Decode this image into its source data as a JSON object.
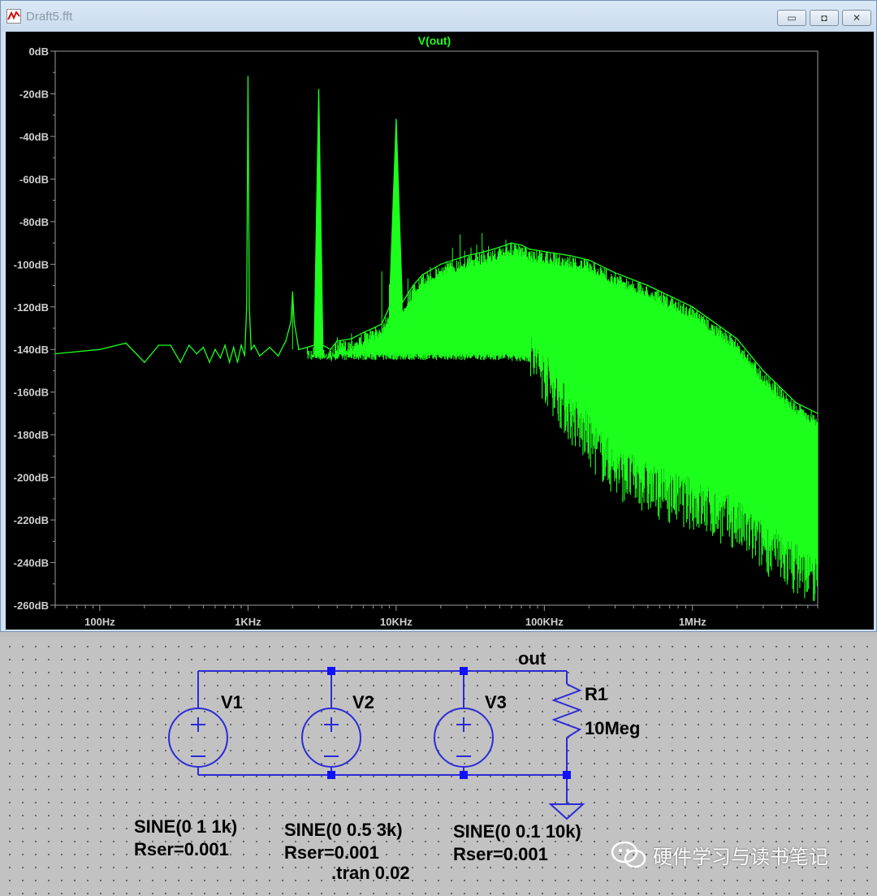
{
  "window": {
    "title": "Draft5.fft",
    "buttons": {
      "minimize": "minimize",
      "maximize": "maximize",
      "close": "close"
    }
  },
  "plot": {
    "trace_name": "V(out)",
    "trace_color": "#1cff1c",
    "background": "#000000"
  },
  "chart_data": {
    "type": "line",
    "title": "V(out)",
    "xscale": "log",
    "xlim": [
      50,
      7000000
    ],
    "ylim": [
      -260,
      0
    ],
    "yticks": [
      "0dB",
      "-20dB",
      "-40dB",
      "-60dB",
      "-80dB",
      "-100dB",
      "-120dB",
      "-140dB",
      "-160dB",
      "-180dB",
      "-200dB",
      "-220dB",
      "-240dB",
      "-260dB"
    ],
    "xticks": [
      "100Hz",
      "1KHz",
      "10KHz",
      "100KHz",
      "1MHz"
    ],
    "grid": false,
    "series": [
      {
        "name": "V(out)",
        "x": [
          50,
          100,
          150,
          200,
          250,
          300,
          350,
          400,
          450,
          500,
          550,
          600,
          650,
          700,
          750,
          800,
          850,
          900,
          950,
          980,
          1000,
          1020,
          1050,
          1100,
          1200,
          1400,
          1600,
          1800,
          1950,
          2000,
          2050,
          2200,
          2500,
          2800,
          3000,
          3200,
          3600,
          4000,
          5000,
          6000,
          7000,
          8000,
          9000,
          10000,
          11000,
          13000,
          15000,
          20000,
          30000,
          40000,
          50000,
          60000,
          70000,
          80000,
          100000,
          150000,
          200000,
          300000,
          500000,
          1000000,
          2000000,
          3000000,
          5000000,
          7000000
        ],
        "values": [
          -142,
          -140,
          -137,
          -146,
          -138,
          -138,
          -146,
          -138,
          -142,
          -139,
          -146,
          -140,
          -144,
          -138,
          -146,
          -139,
          -146,
          -138,
          -143,
          -120,
          -12,
          -120,
          -140,
          -138,
          -143,
          -139,
          -143,
          -136,
          -127,
          -113,
          -127,
          -140,
          -139,
          -138,
          -18,
          -138,
          -140,
          -136,
          -135,
          -132,
          -130,
          -128,
          -120,
          -32,
          -118,
          -110,
          -105,
          -100,
          -96,
          -94,
          -92,
          -90,
          -91,
          -93,
          -94,
          -96,
          -98,
          -104,
          -110,
          -120,
          -135,
          -150,
          -165,
          -170
        ]
      }
    ],
    "envelope_lower": {
      "x": [
        50,
        1000,
        10000,
        50000,
        80000,
        100000,
        150000,
        300000,
        600000,
        1000000,
        2000000,
        3000000,
        5000000,
        7000000
      ],
      "values": [
        -142,
        -145,
        -145,
        -145,
        -146,
        -155,
        -175,
        -200,
        -210,
        -215,
        -225,
        -235,
        -245,
        -252
      ]
    }
  },
  "schematic": {
    "net_label": "out",
    "sources": [
      {
        "name": "V1",
        "line1": "SINE(0 1 1k)",
        "line2": "Rser=0.001"
      },
      {
        "name": "V2",
        "line1": "SINE(0 0.5 3k)",
        "line2": "Rser=0.001"
      },
      {
        "name": "V3",
        "line1": "SINE(0 0.1 10k)",
        "line2": "Rser=0.001"
      }
    ],
    "resistor": {
      "name": "R1",
      "value": "10Meg"
    },
    "directive": ".tran 0.02",
    "wire_color": "#2b2bd8",
    "node_color": "#1010ff"
  },
  "watermark": {
    "text": "硬件学习与读书笔记"
  }
}
